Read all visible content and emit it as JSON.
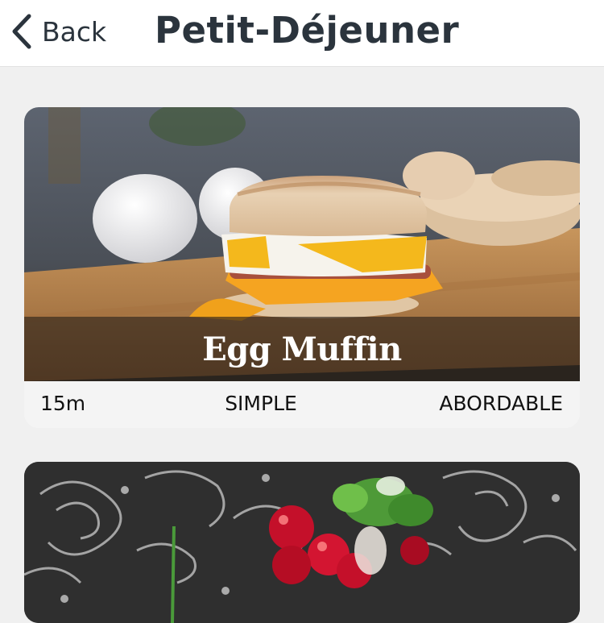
{
  "header": {
    "back_label": "Back",
    "title": "Petit-Déjeuner"
  },
  "meals": [
    {
      "title": "Egg Muffin",
      "duration": "15m",
      "complexity": "SIMPLE",
      "affordability": "ABORDABLE"
    }
  ],
  "colors": {
    "header_text": "#2b343d",
    "background": "#f0f0f0",
    "card_footer": "#f4f4f4",
    "caption_overlay": "rgba(40,32,26,0.62)"
  },
  "icons": {
    "back": "chevron-left-icon"
  }
}
